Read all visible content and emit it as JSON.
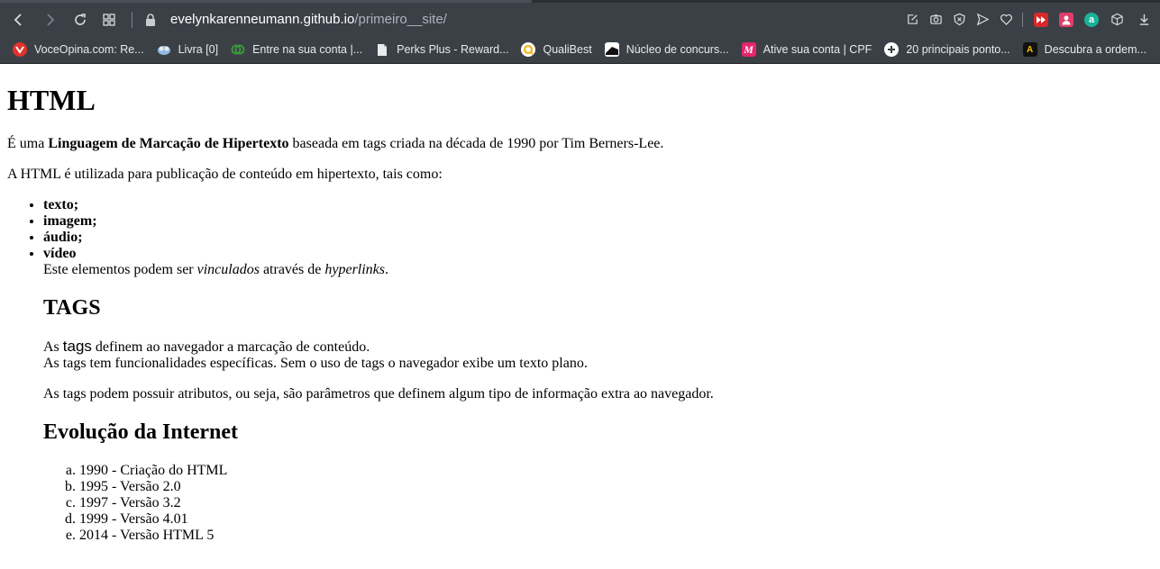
{
  "browser": {
    "url_domain": "evelynkarenneumann.github.io",
    "url_path": "/primeiro__site/"
  },
  "bookmarks": [
    {
      "label": "VoceOpina.com: Re...",
      "icon": "voceopina-icon",
      "color": "#e0322b"
    },
    {
      "label": "Livra [0]",
      "icon": "livra-icon",
      "color": "#6ea6d8"
    },
    {
      "label": "Entre na sua conta |...",
      "icon": "ring-icon",
      "color": "#3b9b3b"
    },
    {
      "label": "Perks Plus - Reward...",
      "icon": "file-icon",
      "color": "#e8eaed"
    },
    {
      "label": "QualiBest",
      "icon": "qualibest-icon",
      "color": "#f2b51c"
    },
    {
      "label": "Núcleo de concurs...",
      "icon": "nucleo-icon",
      "color": "#ffffff"
    },
    {
      "label": "Ative sua conta | CPF",
      "icon": "m-icon",
      "color": "#e5266c"
    },
    {
      "label": "20 principais ponto...",
      "icon": "plus-circle-icon",
      "color": "#ffffff"
    },
    {
      "label": "Descubra a ordem...",
      "icon": "a-icon",
      "color": "#f2c200"
    }
  ],
  "content": {
    "title": "HTML",
    "intro_pre": "É uma ",
    "intro_bold": "Linguagem de Marcação de Hipertexto",
    "intro_post": " baseada em tags criada na década de 1990 por Tim Berners-Lee.",
    "usage": "A HTML é utilizada para publicação de conteúdo em hipertexto, tais como:",
    "media_items": [
      "texto;",
      "imagem;",
      "áudio;",
      "vídeo"
    ],
    "linked_pre": "Este elementos podem ser ",
    "linked_em1": "vinculados",
    "linked_mid": " através de ",
    "linked_em2": "hyperlinks",
    "linked_post": ".",
    "tags_heading": "TAGS",
    "tags_p1_pre": "As ",
    "tags_p1_word": "tags",
    "tags_p1_post": " definem ao navegador a marcação de conteúdo.",
    "tags_p1_line2": "As tags tem funcionalidades específicas. Sem o uso de tags o navegador exibe um texto plano.",
    "tags_p2": "As tags podem possuir atributos, ou seja, são parâmetros que definem algum tipo de informação extra ao navegador.",
    "evolution_heading": "Evolução da Internet",
    "evolution_items": [
      "1990 - Criação do HTML",
      "1995 - Versão 2.0",
      "1997 - Versão 3.2",
      "1999 - Versão 4.01",
      "2014 - Versão HTML 5"
    ]
  }
}
